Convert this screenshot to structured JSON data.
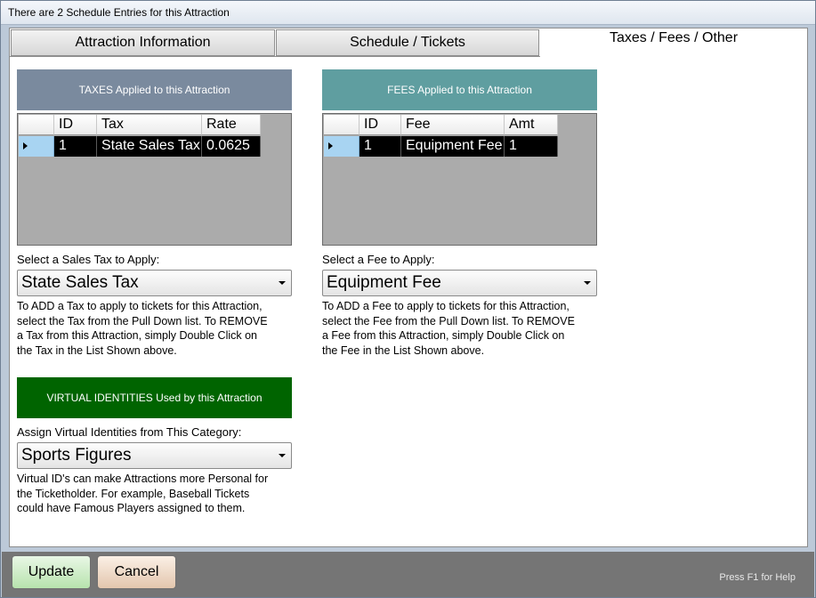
{
  "window": {
    "title": "There are 2 Schedule Entries for this Attraction"
  },
  "tabs": [
    {
      "label": "Attraction Information"
    },
    {
      "label": "Schedule / Tickets"
    },
    {
      "label": "Taxes / Fees / Other"
    }
  ],
  "taxes": {
    "header": "TAXES Applied to this Attraction",
    "header_color": "#7a8a9e",
    "columns": [
      "ID",
      "Tax",
      "Rate"
    ],
    "rows": [
      {
        "id": "1",
        "tax": "State Sales Tax",
        "rate": "0.0625"
      }
    ],
    "select_label": "Select a Sales Tax to Apply:",
    "selected": "State Sales Tax",
    "help": "To ADD a Tax to apply to tickets for this Attraction, select the Tax from the Pull Down list.  To REMOVE a Tax from this Attraction, simply Double Click on the Tax in the List Shown above.",
    "help_lines": [
      "To ADD a Tax to apply to tickets for this Attraction,",
      "select the Tax from the Pull Down list.  To REMOVE",
      "a Tax from this Attraction, simply Double Click on",
      "the Tax in the List Shown above."
    ]
  },
  "fees": {
    "header": "FEES Applied to this Attraction",
    "header_color": "#5f9ea0",
    "columns": [
      "ID",
      "Fee",
      "Amt"
    ],
    "rows": [
      {
        "id": "1",
        "fee": "Equipment Fee",
        "amt": "1"
      }
    ],
    "select_label": "Select a Fee to Apply:",
    "selected": "Equipment Fee",
    "help_lines": [
      "To ADD a Fee to apply to tickets for this Attraction,",
      "select the Fee from the Pull Down list.  To REMOVE",
      "a Fee from this Attraction, simply Double Click on",
      "the Fee in the List Shown above."
    ]
  },
  "virtual": {
    "header": "VIRTUAL IDENTITIES Used by this Attraction",
    "header_color": "#006400",
    "select_label": "Assign Virtual Identities from This Category:",
    "selected": "Sports Figures",
    "help_lines": [
      "Virtual ID's can make Attractions more Personal for",
      "the Ticketholder.  For example, Baseball Tickets",
      "could have Famous Players assigned to them."
    ]
  },
  "buttons": {
    "update": "Update",
    "cancel": "Cancel"
  },
  "footer": {
    "help_hint": "Press F1 for Help"
  },
  "icons": {
    "row_selector": "row-pointer-icon",
    "dropdown_caret": "chevron-down-icon"
  }
}
